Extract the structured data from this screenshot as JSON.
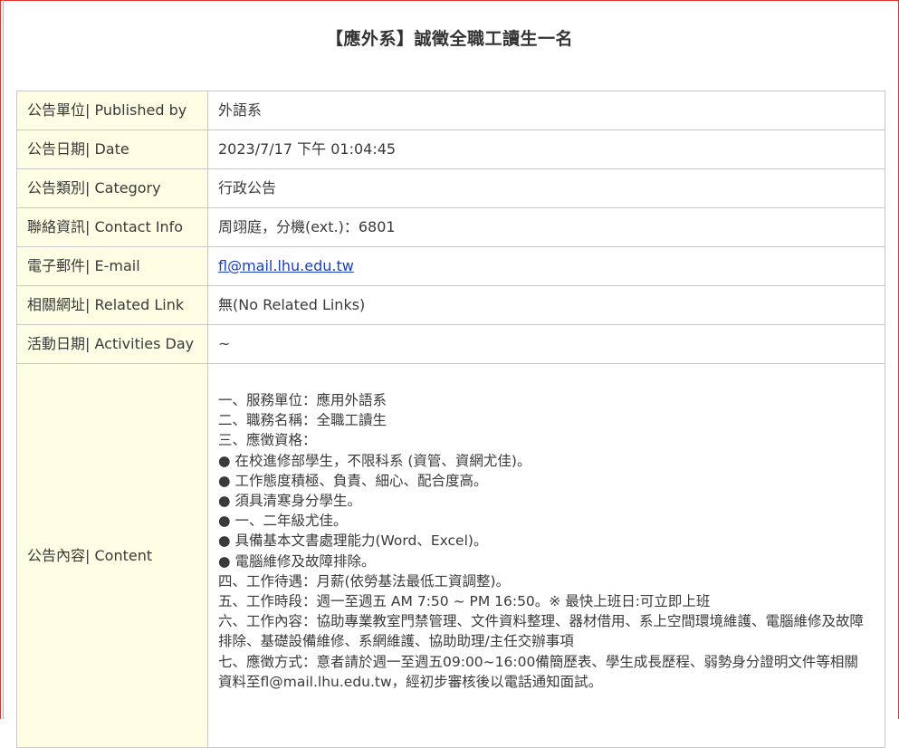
{
  "title": "【應外系】誠徵全職工讀生一名",
  "rows": [
    {
      "label": "公告單位| Published by",
      "value": "外語系"
    },
    {
      "label": "公告日期| Date",
      "value": "2023/7/17 下午 01:04:45"
    },
    {
      "label": "公告類別| Category",
      "value": "行政公告"
    },
    {
      "label": "聯絡資訊| Contact Info",
      "value": "周翊庭，分機(ext.)：6801"
    },
    {
      "label": "電子郵件| E-mail",
      "value": "fl@mail.lhu.edu.tw"
    },
    {
      "label": "相關網址| Related Link",
      "value": "無(No Related Links)"
    },
    {
      "label": "活動日期| Activities Day",
      "value": "~"
    }
  ],
  "content": {
    "label": "公告內容| Content",
    "lines": [
      "一、服務單位：應用外語系",
      "二、職務名稱：全職工讀生",
      "三、應徵資格：",
      "● 在校進修部學生，不限科系 (資管、資網尤佳)。",
      "● 工作態度積極、負責、細心、配合度高。",
      "● 須具清寒身分學生。",
      "● 一、二年級尤佳。",
      "● 具備基本文書處理能力(Word、Excel)。",
      "● 電腦維修及故障排除。",
      "四、工作待遇：月薪(依勞基法最低工資調整)。",
      "五、工作時段：週一至週五 AM 7:50 ~ PM 16:50。※ 最快上班日:可立即上班",
      "六、工作內容：協助專業教室門禁管理、文件資料整理、器材借用、系上空間環境維護、電腦維修及故障排除、基礎設備維修、系網維護、協助助理/主任交辦事項",
      "七、應徵方式：意者請於週一至週五09:00~16:00備簡歷表、學生成長歷程、弱勢身分證明文件等相關資料至fl@mail.lhu.edu.tw，經初步審核後以電話通知面試。"
    ]
  },
  "colors": {
    "label_bg": "#fffde3",
    "border": "#c8c8c8",
    "link": "#1a3fbf",
    "frame": "#e03030"
  }
}
